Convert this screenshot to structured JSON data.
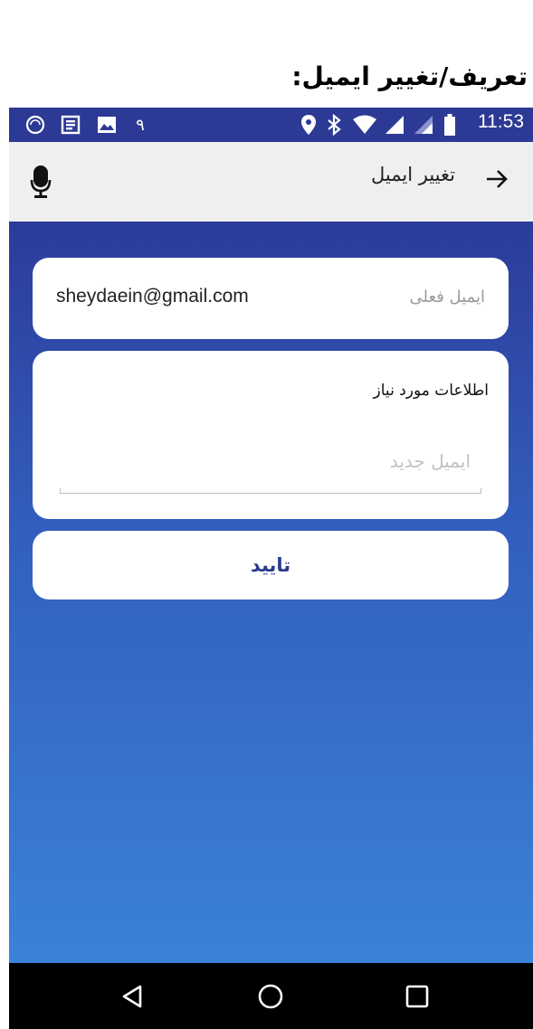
{
  "page_heading": "تعریف/تغییر ایمیل:",
  "status_bar": {
    "time": "11:53",
    "notification_digit": "۹",
    "icons": [
      "sync-icon",
      "notes-icon",
      "image-icon",
      "location-icon",
      "bluetooth-icon",
      "wifi-icon",
      "signal-icon",
      "signal-icon-2",
      "battery-icon"
    ],
    "color": "#2c3a96"
  },
  "app_bar": {
    "title": "تغییر ایمیل",
    "back_icon": "arrow-right-icon",
    "mic_icon": "microphone-icon"
  },
  "current_email": {
    "label": "ایمیل فعلی",
    "value": "sheydaein@gmail.com"
  },
  "new_email": {
    "section_label": "اطلاعات مورد نیاز",
    "placeholder": "ایمیل جدید",
    "value": ""
  },
  "confirm": {
    "label": "تایید"
  },
  "nav_bar": {
    "icons": [
      "back-triangle-icon",
      "home-circle-icon",
      "recents-square-icon"
    ]
  },
  "colors": {
    "gradient_top": "#2c3b9a",
    "gradient_bottom": "#3a82d8",
    "confirm_text": "#2c3a8c"
  }
}
